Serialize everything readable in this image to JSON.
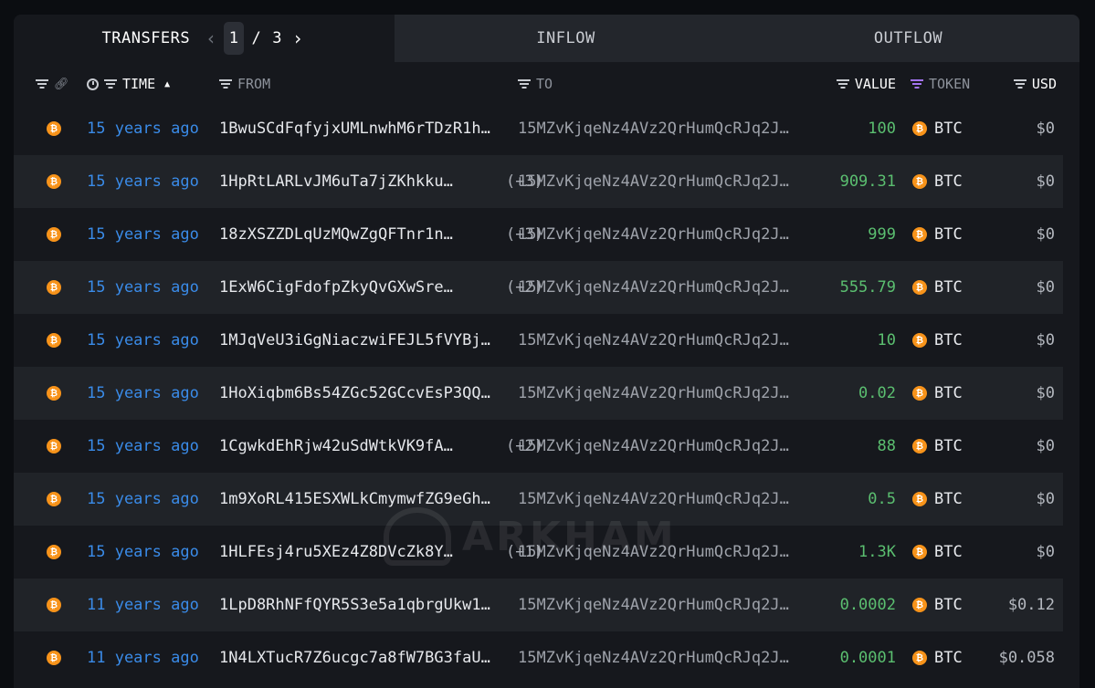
{
  "tabs": {
    "transfers": "TRANSFERS",
    "inflow": "INFLOW",
    "outflow": "OUTFLOW"
  },
  "pagination": {
    "current": "1",
    "separator": "/",
    "total": "3",
    "prev_icon": "chevron-left-icon",
    "next_icon": "chevron-right-icon"
  },
  "columns": {
    "time": "TIME",
    "from": "FROM",
    "to": "TO",
    "value": "VALUE",
    "token": "TOKEN",
    "usd": "USD"
  },
  "watermark": "ARKHAM",
  "colors": {
    "time_link": "#3a8be8",
    "value_positive": "#5bbf70",
    "btc_orange": "#f7931a",
    "token_filter": "#a474f2"
  },
  "rows": [
    {
      "time": "15 years ago",
      "from": "1BwuSCdFqfyjxUMLnwhM6rTDzR1h…",
      "from_extra": "",
      "to": "15MZvKjqeNz4AVz2QrHumQcRJq2J…",
      "value": "100",
      "token": "BTC",
      "usd": "$0"
    },
    {
      "time": "15 years ago",
      "from": "1HpRtLARLvJM6uTa7jZKhkku…",
      "from_extra": "(+3)",
      "to": "15MZvKjqeNz4AVz2QrHumQcRJq2J…",
      "value": "909.31",
      "token": "BTC",
      "usd": "$0"
    },
    {
      "time": "15 years ago",
      "from": "18zXSZZDLqUzMQwZgQFTnr1n…",
      "from_extra": "(+3)",
      "to": "15MZvKjqeNz4AVz2QrHumQcRJq2J…",
      "value": "999",
      "token": "BTC",
      "usd": "$0"
    },
    {
      "time": "15 years ago",
      "from": "1ExW6CigFdofpZkyQvGXwSre…",
      "from_extra": "(+2)",
      "to": "15MZvKjqeNz4AVz2QrHumQcRJq2J…",
      "value": "555.79",
      "token": "BTC",
      "usd": "$0"
    },
    {
      "time": "15 years ago",
      "from": "1MJqVeU3iGgNiaczwiFEJL5fVYBj…",
      "from_extra": "",
      "to": "15MZvKjqeNz4AVz2QrHumQcRJq2J…",
      "value": "10",
      "token": "BTC",
      "usd": "$0"
    },
    {
      "time": "15 years ago",
      "from": "1HoXiqbm6Bs54ZGc52GCcvEsP3QQ…",
      "from_extra": "",
      "to": "15MZvKjqeNz4AVz2QrHumQcRJq2J…",
      "value": "0.02",
      "token": "BTC",
      "usd": "$0"
    },
    {
      "time": "15 years ago",
      "from": "1CgwkdEhRjw42uSdWtkVK9fA…",
      "from_extra": "(+2)",
      "to": "15MZvKjqeNz4AVz2QrHumQcRJq2J…",
      "value": "88",
      "token": "BTC",
      "usd": "$0"
    },
    {
      "time": "15 years ago",
      "from": "1m9XoRL415ESXWLkCmymwfZG9eGh…",
      "from_extra": "",
      "to": "15MZvKjqeNz4AVz2QrHumQcRJq2J…",
      "value": "0.5",
      "token": "BTC",
      "usd": "$0"
    },
    {
      "time": "15 years ago",
      "from": "1HLFEsj4ru5XEz4Z8DVcZk8Y…",
      "from_extra": "(+1)",
      "to": "15MZvKjqeNz4AVz2QrHumQcRJq2J…",
      "value": "1.3K",
      "token": "BTC",
      "usd": "$0"
    },
    {
      "time": "11 years ago",
      "from": "1LpD8RhNFfQYR5S3e5a1qbrgUkw1…",
      "from_extra": "",
      "to": "15MZvKjqeNz4AVz2QrHumQcRJq2J…",
      "value": "0.0002",
      "token": "BTC",
      "usd": "$0.12"
    },
    {
      "time": "11 years ago",
      "from": "1N4LXTucR7Z6ucgc7a8fW7BG3faU…",
      "from_extra": "",
      "to": "15MZvKjqeNz4AVz2QrHumQcRJq2J…",
      "value": "0.0001",
      "token": "BTC",
      "usd": "$0.058"
    }
  ]
}
